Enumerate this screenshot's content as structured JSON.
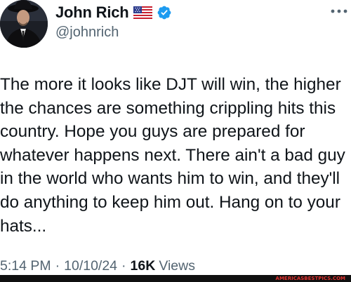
{
  "author": {
    "display_name": "John Rich",
    "handle": "@johnrich",
    "avatar_icon": "profile-photo",
    "name_emoji_icon": "us-flag-icon",
    "verified_icon": "verified-badge-icon",
    "verified_color": "#1d9bf0"
  },
  "tweet": {
    "text": "The more it looks like DJT will win, the higher\nthe chances are something crippling hits this\ncountry. Hope you guys are prepared for\nwhatever happens next. There ain't a bad guy\nin the world who wants him to win, and they'll\ndo anything to keep him out. Hang on to your\nhats...",
    "time": "5:14 PM",
    "date": "10/10/24",
    "separator": "·",
    "views_count": "16K",
    "views_label": "Views"
  },
  "more_menu_icon": "more-horizontal-icon",
  "watermark": {
    "text": "AMERICASBESTPICS.COM"
  },
  "colors": {
    "text_primary": "#0f1419",
    "text_secondary": "#536471",
    "background": "#ffffff"
  }
}
